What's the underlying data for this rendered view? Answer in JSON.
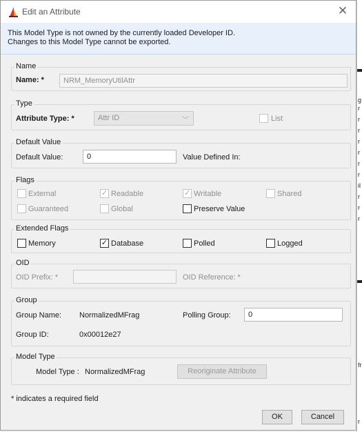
{
  "window": {
    "title": "Edit an Attribute",
    "close_glyph": "✕"
  },
  "banner": {
    "line1": "This Model Type is not owned by the currently loaded Developer ID.",
    "line2": "Changes to this Model Type cannot be exported."
  },
  "name_group": {
    "legend": "Name",
    "label": "Name: *",
    "value": "NRM_MemoryUtilAttr"
  },
  "type_group": {
    "legend": "Type",
    "label": "Attribute Type: *",
    "selected": "Attr ID",
    "list_label": "List",
    "list_checked": false
  },
  "default_group": {
    "legend": "Default Value",
    "label": "Default Value:",
    "value": "0",
    "defined_in_label": "Value Defined In:"
  },
  "flags": {
    "legend": "Flags",
    "external": {
      "label": "External",
      "checked": ""
    },
    "readable": {
      "label": "Readable",
      "checked": "✓"
    },
    "writable": {
      "label": "Writable",
      "checked": "✓"
    },
    "shared": {
      "label": "Shared",
      "checked": ""
    },
    "guaranteed": {
      "label": "Guaranteed",
      "checked": ""
    },
    "global": {
      "label": "Global",
      "checked": ""
    },
    "preserve": {
      "label": "Preserve Value",
      "checked": ""
    }
  },
  "extended_flags": {
    "legend": "Extended Flags",
    "memory": {
      "label": "Memory",
      "checked": ""
    },
    "database": {
      "label": "Database",
      "checked": "✓"
    },
    "polled": {
      "label": "Polled",
      "checked": ""
    },
    "logged": {
      "label": "Logged",
      "checked": ""
    }
  },
  "oid_group": {
    "legend": "OID",
    "prefix_label": "OID Prefix: *",
    "prefix_value": "",
    "reference_label": "OID Reference: *"
  },
  "group_group": {
    "legend": "Group",
    "group_name_label": "Group Name:",
    "group_name_value": "NormalizedMFrag",
    "polling_label": "Polling Group:",
    "polling_value": "0",
    "group_id_label": "Group ID:",
    "group_id_value": "0x00012e27"
  },
  "model_type_group": {
    "legend": "Model Type",
    "label": "Model Type :",
    "value": "NormalizedMFrag",
    "reoriginate_label": "Reoriginate Attribute"
  },
  "footer": {
    "note": "* indicates a required field",
    "ok_label": "OK",
    "cancel_label": "Cancel"
  },
  "background_fragments": [
    "g",
    "r",
    "r",
    "r",
    "r",
    "r",
    "r",
    "r",
    "il",
    "r",
    "r",
    "r",
    "fr",
    "r"
  ],
  "colors": {
    "banner_bg": "#e8f1fb",
    "dialog_bg": "#f0f0f0",
    "icon_red": "#d9342b"
  }
}
